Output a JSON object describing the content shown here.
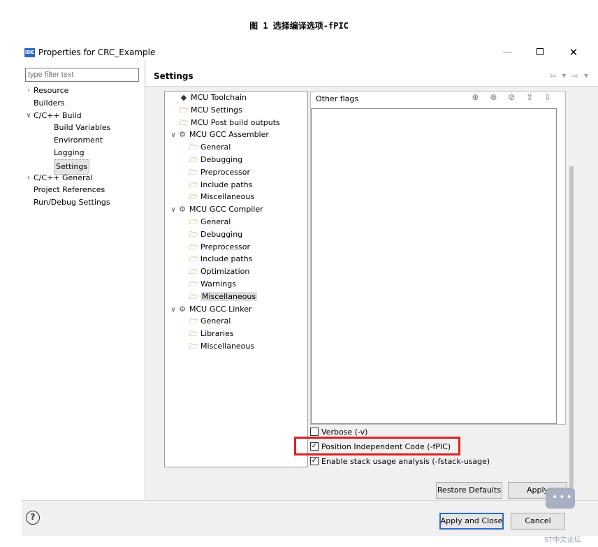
{
  "caption": "图 1 选择编译选项-fPIC",
  "window": {
    "logo": "IDE",
    "title": "Properties for CRC_Example"
  },
  "filter": {
    "placeholder": "type filter text"
  },
  "nav": [
    {
      "label": "Resource",
      "twisty": "right",
      "indent": 0
    },
    {
      "label": "Builders",
      "twisty": "",
      "indent": 0
    },
    {
      "label": "C/C++ Build",
      "twisty": "down",
      "indent": 0
    },
    {
      "label": "Build Variables",
      "twisty": "",
      "indent": 1
    },
    {
      "label": "Environment",
      "twisty": "",
      "indent": 1
    },
    {
      "label": "Logging",
      "twisty": "",
      "indent": 1
    },
    {
      "label": "Settings",
      "twisty": "",
      "indent": 1,
      "selected": true
    },
    {
      "label": "C/C++ General",
      "twisty": "right",
      "indent": 0
    },
    {
      "label": "Project References",
      "twisty": "",
      "indent": 0
    },
    {
      "label": "Run/Debug Settings",
      "twisty": "",
      "indent": 0
    }
  ],
  "settings": {
    "title": "Settings",
    "nav_arrows": "⇦ ▾ ⇨ ▾"
  },
  "tree": [
    {
      "label": "MCU Toolchain",
      "icon": "chip-icon",
      "level": 1,
      "twisty": ""
    },
    {
      "label": "MCU Settings",
      "icon": "settings-folder-icon",
      "level": 1,
      "twisty": ""
    },
    {
      "label": "MCU Post build outputs",
      "icon": "settings-folder-icon",
      "level": 1,
      "twisty": ""
    },
    {
      "label": "MCU GCC Assembler",
      "icon": "gear-icon",
      "level": 0,
      "twisty": "down"
    },
    {
      "label": "General",
      "icon": "settings-folder-icon",
      "level": 2,
      "twisty": ""
    },
    {
      "label": "Debugging",
      "icon": "settings-folder-icon",
      "level": 2,
      "twisty": ""
    },
    {
      "label": "Preprocessor",
      "icon": "settings-folder-icon",
      "level": 2,
      "twisty": ""
    },
    {
      "label": "Include paths",
      "icon": "settings-folder-icon",
      "level": 2,
      "twisty": ""
    },
    {
      "label": "Miscellaneous",
      "icon": "settings-folder-icon",
      "level": 2,
      "twisty": ""
    },
    {
      "label": "MCU GCC Compiler",
      "icon": "gear-icon",
      "level": 0,
      "twisty": "down"
    },
    {
      "label": "General",
      "icon": "settings-folder-icon",
      "level": 2,
      "twisty": ""
    },
    {
      "label": "Debugging",
      "icon": "settings-folder-icon",
      "level": 2,
      "twisty": ""
    },
    {
      "label": "Preprocessor",
      "icon": "settings-folder-icon",
      "level": 2,
      "twisty": ""
    },
    {
      "label": "Include paths",
      "icon": "settings-folder-icon",
      "level": 2,
      "twisty": ""
    },
    {
      "label": "Optimization",
      "icon": "settings-folder-icon",
      "level": 2,
      "twisty": ""
    },
    {
      "label": "Warnings",
      "icon": "settings-folder-icon",
      "level": 2,
      "twisty": ""
    },
    {
      "label": "Miscellaneous",
      "icon": "settings-folder-icon",
      "level": 2,
      "twisty": "",
      "selected": true
    },
    {
      "label": "MCU GCC Linker",
      "icon": "gear-icon",
      "level": 0,
      "twisty": "down"
    },
    {
      "label": "General",
      "icon": "settings-folder-icon",
      "level": 2,
      "twisty": ""
    },
    {
      "label": "Libraries",
      "icon": "settings-folder-icon",
      "level": 2,
      "twisty": ""
    },
    {
      "label": "Miscellaneous",
      "icon": "settings-folder-icon",
      "level": 2,
      "twisty": ""
    }
  ],
  "flags": {
    "label": "Other flags",
    "tools": "⊕ ⊗ ⊘ ⇧ ⇩"
  },
  "options": {
    "verbose": {
      "label": "Verbose (-v)",
      "checked": false
    },
    "pic": {
      "label": "Position Independent Code (-fPIC)",
      "checked": true
    },
    "stack": {
      "label": "Enable stack usage analysis (-fstack-usage)",
      "checked": true
    }
  },
  "buttons": {
    "restore": "Restore Defaults",
    "apply": "Apply",
    "apply_close": "Apply and Close",
    "cancel": "Cancel",
    "help": "?"
  },
  "watermark": "ST中文论坛",
  "colors": {
    "highlight": "#e02020",
    "primary_border": "#2a6ad0"
  }
}
